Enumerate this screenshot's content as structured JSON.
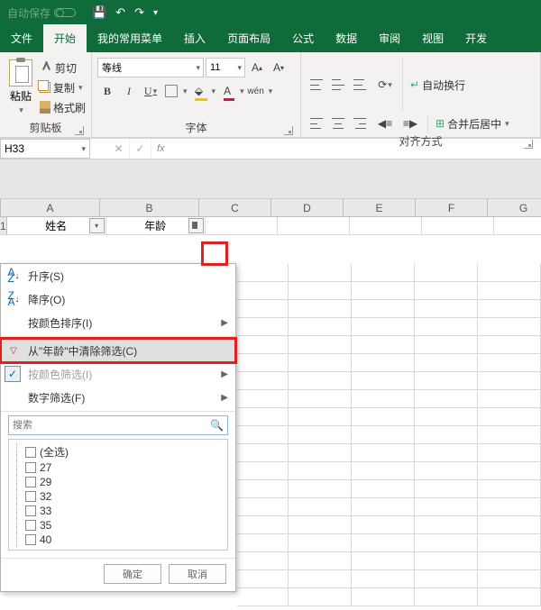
{
  "titlebar": {
    "autosave": "自动保存"
  },
  "tabs": {
    "file": "文件",
    "home": "开始",
    "custom": "我的常用菜单",
    "insert": "插入",
    "layout": "页面布局",
    "formula": "公式",
    "data": "数据",
    "review": "审阅",
    "view": "视图",
    "dev": "开发"
  },
  "ribbon": {
    "clipboard": {
      "paste": "粘贴",
      "cut": "剪切",
      "copy": "复制",
      "format": "格式刷",
      "label": "剪贴板"
    },
    "font": {
      "name": "等线",
      "size": "11",
      "label": "字体",
      "wen": "wén"
    },
    "align": {
      "wrap": "自动换行",
      "merge": "合并后居中",
      "label": "对齐方式"
    }
  },
  "namebox": "H33",
  "headers": {
    "a": "A",
    "b": "B",
    "c": "C",
    "d": "D",
    "e": "E",
    "f": "F",
    "g": "G"
  },
  "row1": {
    "num": "1",
    "a": "姓名",
    "b": "年龄"
  },
  "filter": {
    "asc": "升序(S)",
    "desc": "降序(O)",
    "sortcolor": "按颜色排序(I)",
    "clear": "从\"年龄\"中清除筛选(C)",
    "filtercolor": "按颜色筛选(I)",
    "numfilter": "数字筛选(F)",
    "search_ph": "搜索",
    "items": [
      "(全选)",
      "27",
      "29",
      "32",
      "33",
      "35",
      "40"
    ],
    "ok": "确定",
    "cancel": "取消"
  }
}
